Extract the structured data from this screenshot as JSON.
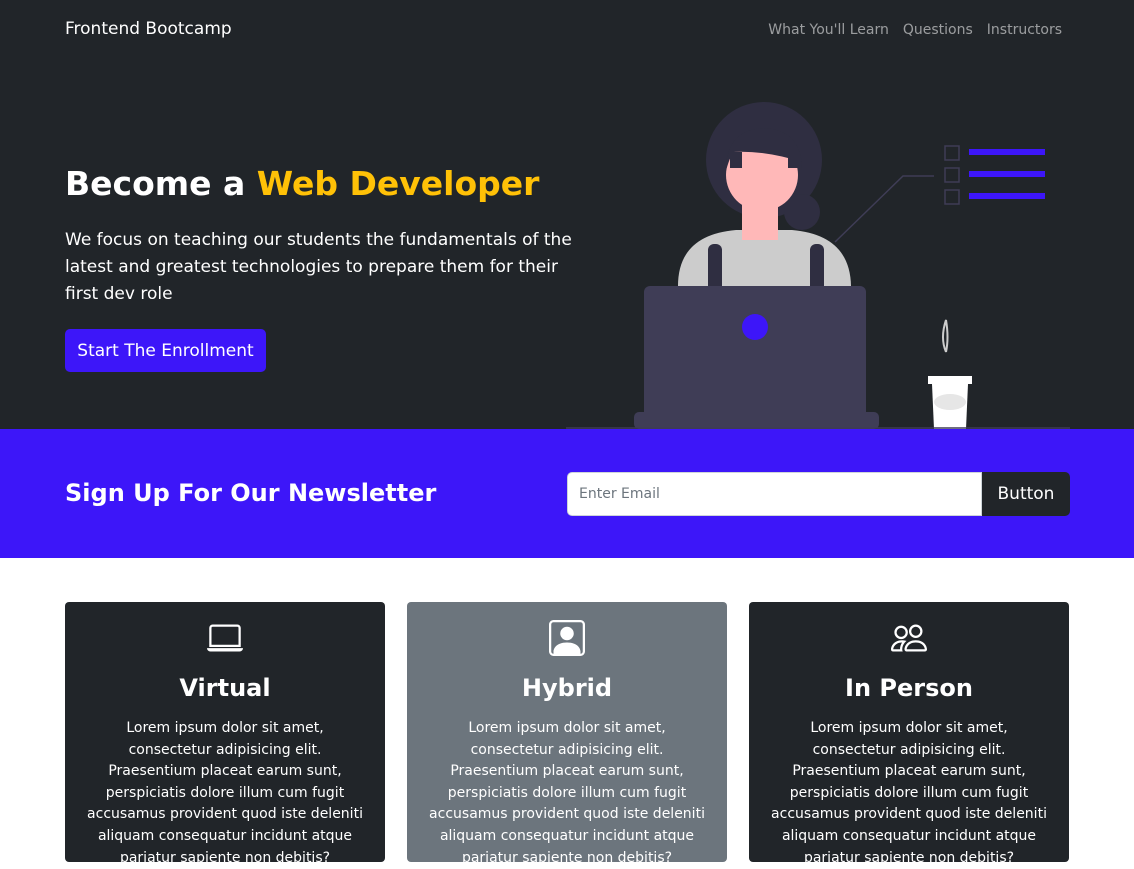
{
  "navbar": {
    "brand": "Frontend Bootcamp",
    "links": [
      "What You'll Learn",
      "Questions",
      "Instructors"
    ]
  },
  "hero": {
    "title_prefix": "Become a ",
    "title_highlight": "Web Developer",
    "lead": "We focus on teaching our students the fundamentals of the latest and greatest technologies to prepare them for their first dev role",
    "button_label": "Start The Enrollment"
  },
  "newsletter": {
    "title": "Sign Up For Our Newsletter",
    "input_placeholder": "Enter Email",
    "input_value": "",
    "button_label": "Button"
  },
  "cards": [
    {
      "icon": "laptop-icon",
      "title": "Virtual",
      "text": "Lorem ipsum dolor sit amet, consectetur adipisicing elit. Praesentium placeat earum sunt, perspiciatis dolore illum cum fugit accusamus provident quod iste deleniti aliquam consequatur incidunt atque pariatur sapiente non debitis?"
    },
    {
      "icon": "person-square-icon",
      "title": "Hybrid",
      "text": "Lorem ipsum dolor sit amet, consectetur adipisicing elit. Praesentium placeat earum sunt, perspiciatis dolore illum cum fugit accusamus provident quod iste deleniti aliquam consequatur incidunt atque pariatur sapiente non debitis?"
    },
    {
      "icon": "people-icon",
      "title": "In Person",
      "text": "Lorem ipsum dolor sit amet, consectetur adipisicing elit. Praesentium placeat earum sunt, perspiciatis dolore illum cum fugit accusamus provident quod iste deleniti aliquam consequatur incidunt atque pariatur sapiente non debitis?"
    }
  ],
  "colors": {
    "dark": "#212529",
    "primary": "#3d16f9",
    "highlight": "#ffc107",
    "secondary": "#6c757d"
  }
}
